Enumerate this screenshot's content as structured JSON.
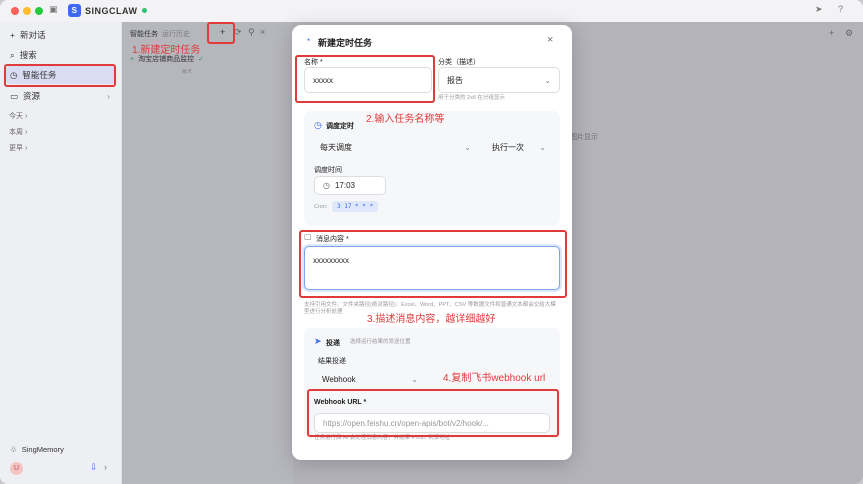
{
  "app": {
    "name": "SINGCLAW"
  },
  "sidebar": {
    "new_chat": "新对话",
    "search": "搜索",
    "smart_tasks": "智能任务",
    "resources": "资源",
    "groups": [
      {
        "label": "今天"
      },
      {
        "label": "本周"
      },
      {
        "label": "更早"
      }
    ],
    "footer_label": "SingMemory",
    "avatar_letter": "U"
  },
  "tasklist": {
    "tab_tasks": "智能任务",
    "tab_history": "运行历史",
    "task_name": "淘宝店铺商品监控",
    "row_text": "每天"
  },
  "modal": {
    "title": "新建定时任务",
    "name_label": "名称 *",
    "name_value": "xxxxx",
    "category_label": "分类（描述）",
    "category_value": "报告",
    "category_hint": "用于分类的 2x6 在分组显示",
    "schedule_title": "调度定时",
    "frequency_value": "每天调度",
    "repeat_value": "执行一次",
    "time_label": "调度时间",
    "time_value": "17:03",
    "cron_label": "Cron:",
    "cron_value": "3 17 * * *",
    "message_label": "消息内容 *",
    "message_value": "xxxxxxxxx",
    "message_hint": "支持引用文件、文件夹路径(绝对路径)：Excel、Word、PPT、CSV 等数据文件和普通文本都会交给大模型进行分析处理",
    "delivery_title": "投递",
    "delivery_hint": "选择运行结果的发送位置",
    "result_label": "结果投递",
    "result_value": "Webhook",
    "webhook_label": "Webhook URL *",
    "webhook_placeholder": "https://open.feishu.cn/open-apis/bot/v2/hook/...",
    "webhook_hint": "任务运行后 AI 会处理消息内容，并结果 POST 到该地址"
  },
  "main": {
    "side_text": "图片显示"
  },
  "annotations": {
    "a1": "1.新建定时任务",
    "a2": "2.输入任务名称等",
    "a3": "3.描述消息内容，越详细越好",
    "a4": "4.复制飞书webhook url"
  },
  "colors": {
    "accent": "#3d6af2",
    "annotation": "#e03a3a",
    "online": "#2fbf71"
  }
}
